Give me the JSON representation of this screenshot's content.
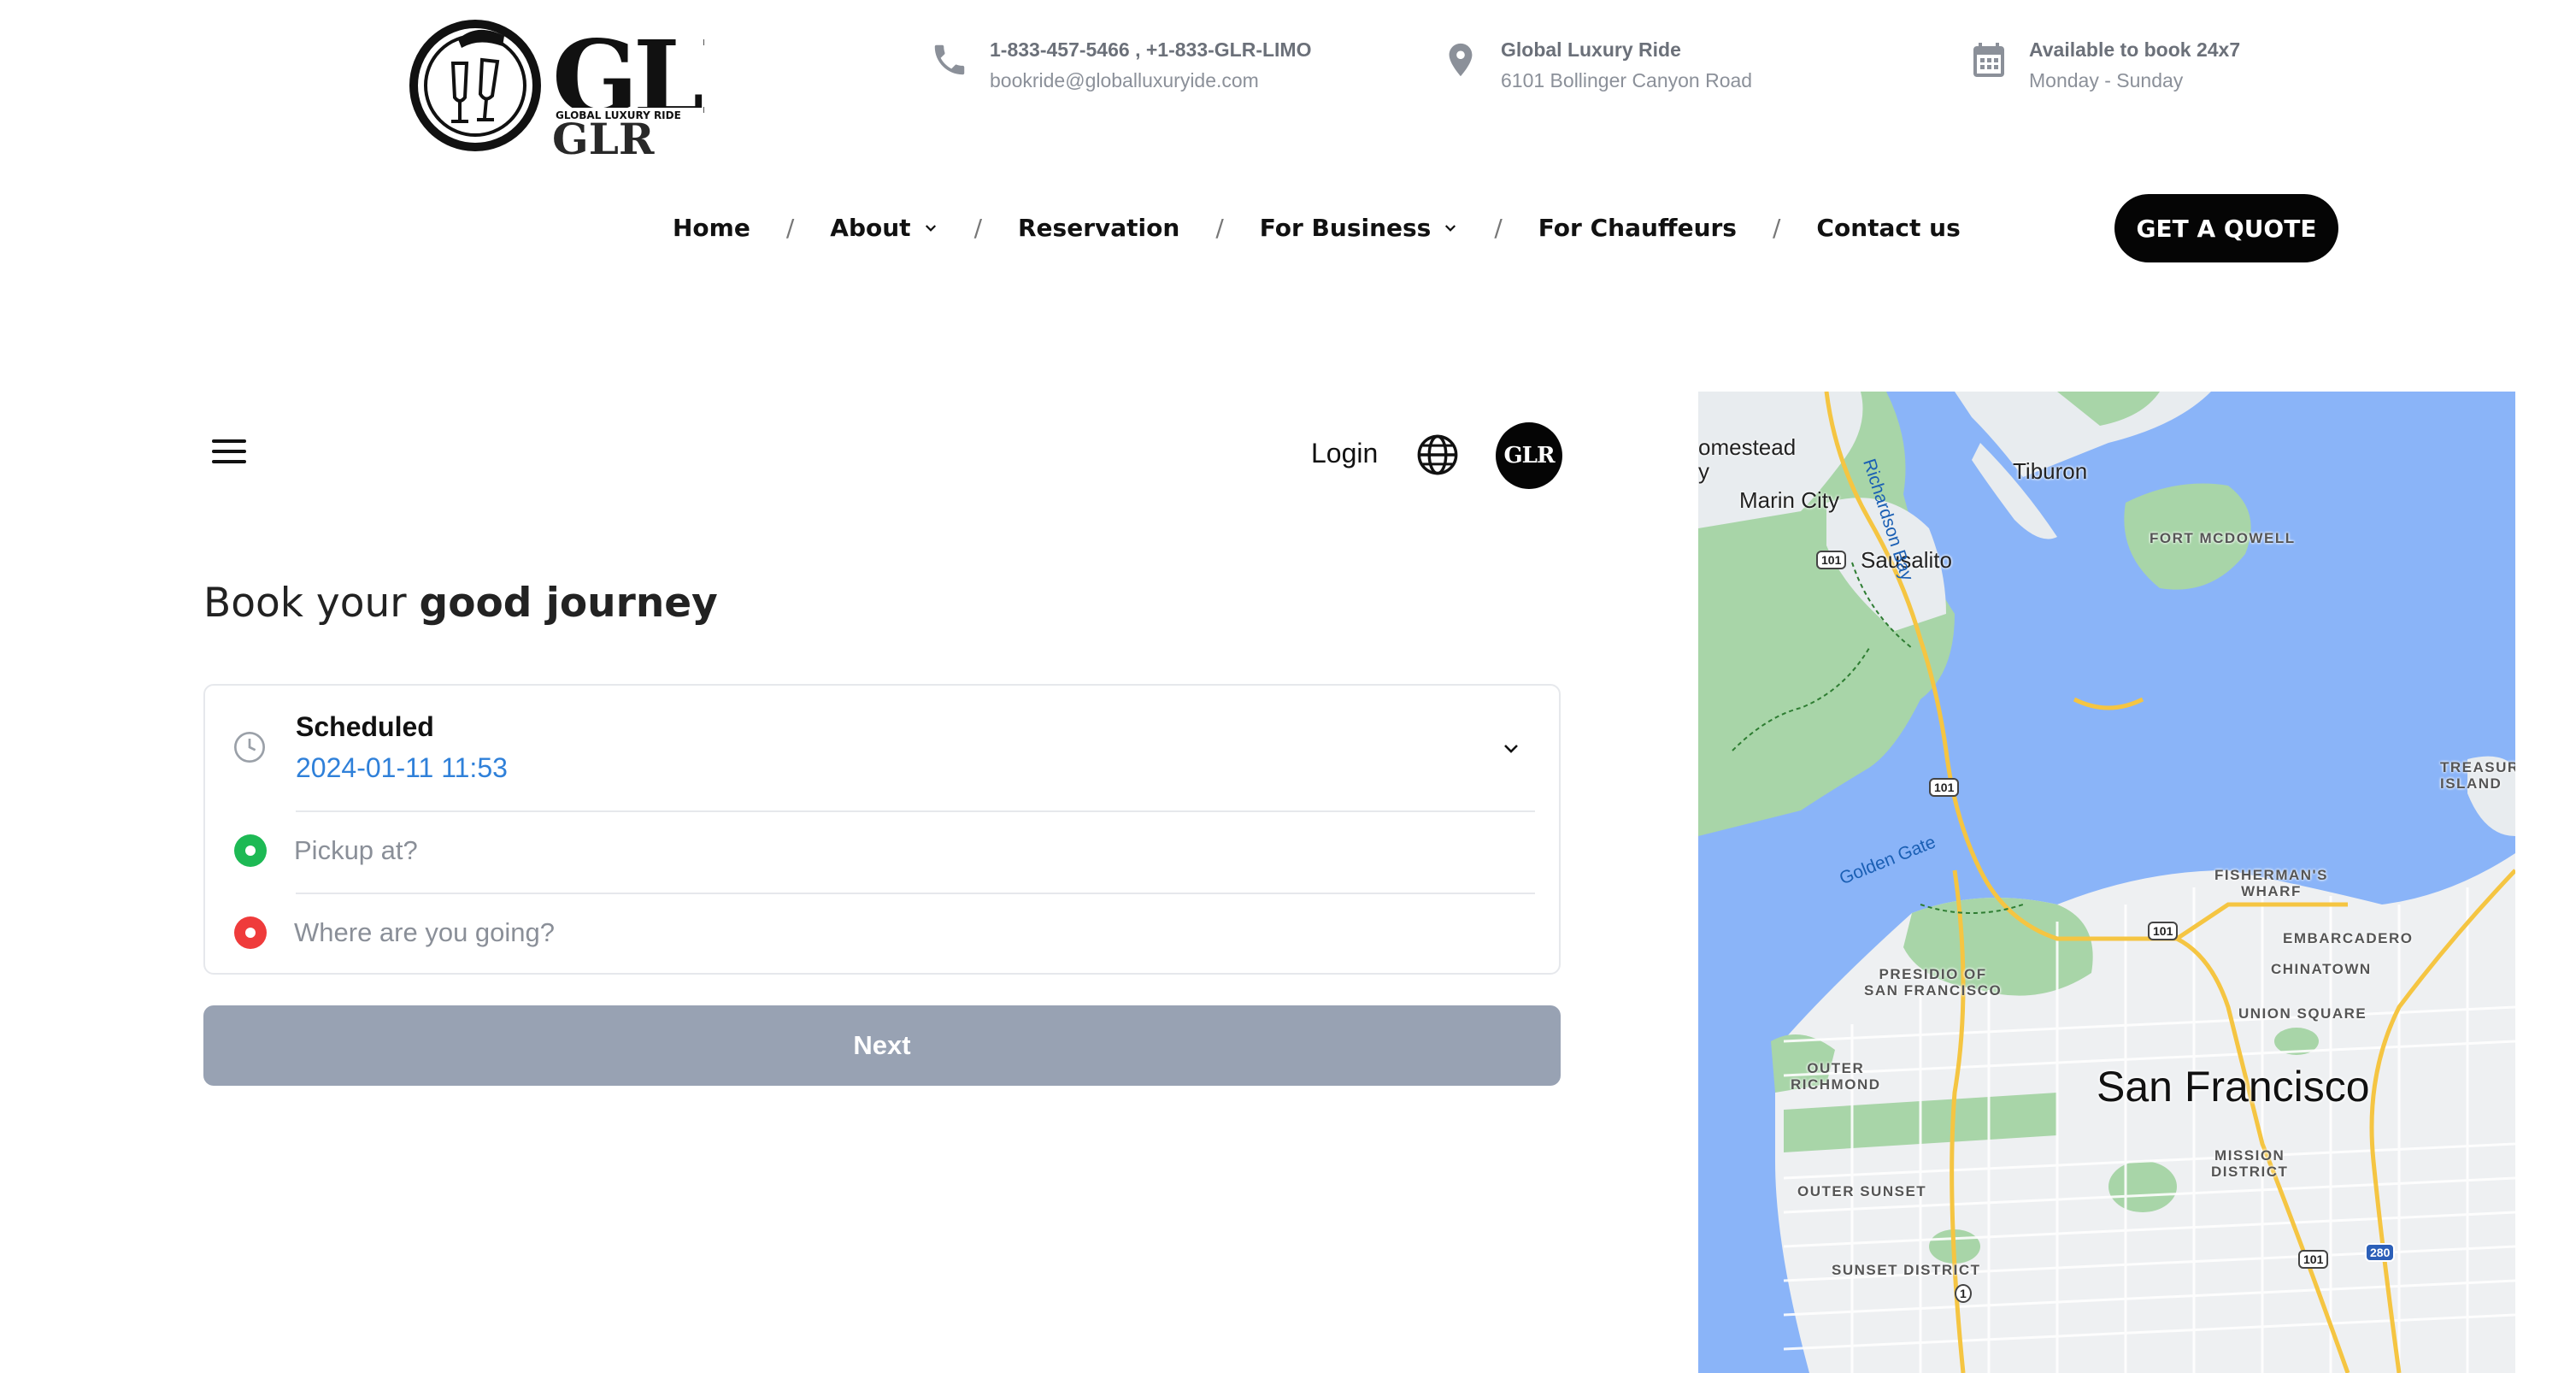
{
  "brand": {
    "logo_text": "GLR",
    "logo_tagline": "GLOBAL LUXURY RIDE"
  },
  "header": {
    "phone": {
      "line1": "1-833-457-5466 , +1-833-GLR-LIMO",
      "line2": "bookride@globalluxuryide.com",
      "icon": "phone-icon"
    },
    "location": {
      "line1": "Global Luxury Ride",
      "line2": "6101 Bollinger Canyon Road",
      "icon": "location-pin-icon"
    },
    "hours": {
      "line1": "Available to book 24x7",
      "line2": "Monday - Sunday",
      "icon": "calendar-icon"
    }
  },
  "nav": {
    "items": [
      {
        "label": "Home",
        "dropdown": false
      },
      {
        "label": "About",
        "dropdown": true
      },
      {
        "label": "Reservation",
        "dropdown": false
      },
      {
        "label": "For Business",
        "dropdown": true
      },
      {
        "label": "For Chauffeurs",
        "dropdown": false
      },
      {
        "label": "Contact us",
        "dropdown": false
      }
    ],
    "separator": "/",
    "cta": "GET A QUOTE"
  },
  "booking": {
    "login": "Login",
    "avatar_text": "GLR",
    "heading_regular": "Book your ",
    "heading_bold": "good journey",
    "schedule_label": "Scheduled",
    "schedule_value": "2024-01-11 11:53",
    "pickup_placeholder": "Pickup at?",
    "destination_placeholder": "Where are you going?",
    "next": "Next"
  },
  "map": {
    "labels": {
      "homestead": "omestead",
      "homestead2": "y",
      "marin_city": "Marin City",
      "sausalito": "Sausalito",
      "tiburon": "Tiburon",
      "fort_mcdowell": "FORT MCDOWELL",
      "richardson_bay": "Richardson Bay",
      "golden_gate": "Golden Gate",
      "treasure_island_1": "TREASUR",
      "treasure_island_2": "ISLAND",
      "fishermans_wharf_1": "FISHERMAN'S",
      "fishermans_wharf_2": "WHARF",
      "embarcadero": "EMBARCADERO",
      "chinatown": "CHINATOWN",
      "union_square": "UNION SQUARE",
      "presidio_1": "PRESIDIO OF",
      "presidio_2": "SAN FRANCISCO",
      "outer_richmond_1": "OUTER",
      "outer_richmond_2": "RICHMOND",
      "san_francisco": "San Francisco",
      "mission_district_1": "MISSION",
      "mission_district_2": "DISTRICT",
      "outer_sunset": "OUTER SUNSET",
      "sunset_district": "SUNSET DISTRICT"
    },
    "shields": [
      "101",
      "101",
      "101",
      "101",
      "280",
      "1"
    ]
  }
}
